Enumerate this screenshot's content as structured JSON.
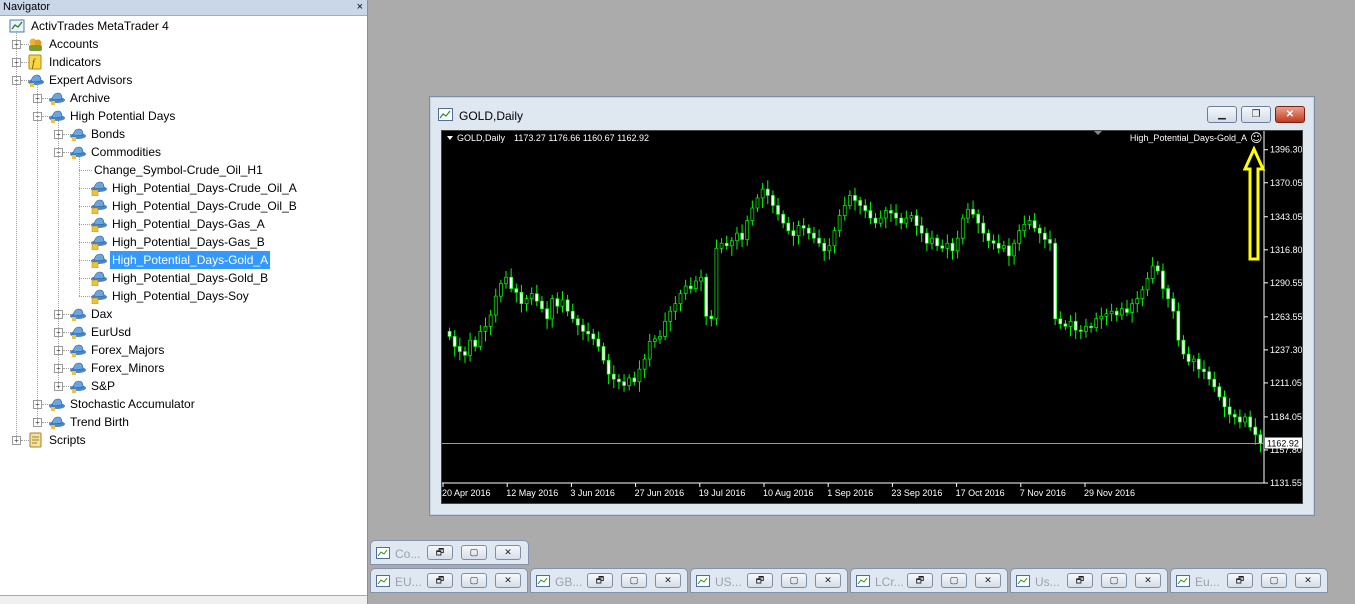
{
  "navigator": {
    "title": "Navigator",
    "close_glyph": "×",
    "tree": [
      {
        "label": "ActivTrades MetaTrader 4",
        "level": 0,
        "expander": "",
        "icon": "terminal-icon"
      },
      {
        "label": "Accounts",
        "level": 1,
        "expander": "+",
        "icon": "accounts-icon"
      },
      {
        "label": "Indicators",
        "level": 1,
        "expander": "+",
        "icon": "indicators-icon"
      },
      {
        "label": "Expert Advisors",
        "level": 1,
        "expander": "-",
        "icon": "expert-hat-icon"
      },
      {
        "label": "Archive",
        "level": 2,
        "expander": "+",
        "icon": "expert-hat-icon"
      },
      {
        "label": "High Potential Days",
        "level": 2,
        "expander": "-",
        "icon": "expert-hat-icon"
      },
      {
        "label": "Bonds",
        "level": 3,
        "expander": "+",
        "icon": "expert-hat-icon"
      },
      {
        "label": "Commodities",
        "level": 3,
        "expander": "-",
        "icon": "expert-hat-icon"
      },
      {
        "label": "Change_Symbol-Crude_Oil_H1",
        "level": 4,
        "expander": "",
        "icon": "none"
      },
      {
        "label": "High_Potential_Days-Crude_Oil_A",
        "level": 4,
        "expander": "",
        "icon": "expert-file-icon"
      },
      {
        "label": "High_Potential_Days-Crude_Oil_B",
        "level": 4,
        "expander": "",
        "icon": "expert-file-icon"
      },
      {
        "label": "High_Potential_Days-Gas_A",
        "level": 4,
        "expander": "",
        "icon": "expert-file-icon"
      },
      {
        "label": "High_Potential_Days-Gas_B",
        "level": 4,
        "expander": "",
        "icon": "expert-file-icon"
      },
      {
        "label": "High_Potential_Days-Gold_A",
        "level": 4,
        "expander": "",
        "icon": "expert-file-icon",
        "selected": true
      },
      {
        "label": "High_Potential_Days-Gold_B",
        "level": 4,
        "expander": "",
        "icon": "expert-file-icon"
      },
      {
        "label": "High_Potential_Days-Soy",
        "level": 4,
        "expander": "",
        "icon": "expert-file-icon"
      },
      {
        "label": "Dax",
        "level": 3,
        "expander": "+",
        "icon": "expert-hat-icon"
      },
      {
        "label": "EurUsd",
        "level": 3,
        "expander": "+",
        "icon": "expert-hat-icon"
      },
      {
        "label": "Forex_Majors",
        "level": 3,
        "expander": "+",
        "icon": "expert-hat-icon"
      },
      {
        "label": "Forex_Minors",
        "level": 3,
        "expander": "+",
        "icon": "expert-hat-icon"
      },
      {
        "label": "S&P",
        "level": 3,
        "expander": "+",
        "icon": "expert-hat-icon"
      },
      {
        "label": "Stochastic Accumulator",
        "level": 2,
        "expander": "+",
        "icon": "expert-hat-icon"
      },
      {
        "label": "Trend Birth",
        "level": 2,
        "expander": "+",
        "icon": "expert-hat-icon"
      },
      {
        "label": "Scripts",
        "level": 1,
        "expander": "+",
        "icon": "scripts-icon"
      }
    ]
  },
  "chart_window": {
    "title": "GOLD,Daily",
    "min_glyph": "▁",
    "restore_glyph": "❐",
    "close_glyph": "✕",
    "info_symbol": "GOLD,Daily",
    "info_ohlc": "1173.27 1176.66 1160.67 1162.92",
    "expert_name": "High_Potential_Days-Gold_A",
    "smiley": "☺",
    "current_price": "1162.92"
  },
  "colors": {
    "candle": "#00ff00",
    "chart_bg": "#000000",
    "axis_text": "#ffffff",
    "arrow": "#ffff00",
    "selection": "#3399ff"
  },
  "chart_data": {
    "type": "candlestick",
    "symbol": "GOLD",
    "timeframe": "Daily",
    "ylim": [
      1131.55,
      1408.0
    ],
    "y_ticks": [
      "1396.30",
      "1370.05",
      "1343.05",
      "1316.80",
      "1290.55",
      "1263.55",
      "1237.30",
      "1211.05",
      "1184.05",
      "1157.80",
      "1131.55"
    ],
    "x_ticks": [
      "20 Apr 2016",
      "12 May 2016",
      "3 Jun 2016",
      "27 Jun 2016",
      "19 Jul 2016",
      "10 Aug 2016",
      "1 Sep 2016",
      "23 Sep 2016",
      "17 Oct 2016",
      "7 Nov 2016",
      "29 Nov 2016"
    ],
    "bid_line": 1162.92,
    "closes": [
      1248,
      1240,
      1236,
      1233,
      1245,
      1240,
      1252,
      1256,
      1265,
      1280,
      1290,
      1295,
      1286,
      1283,
      1274,
      1278,
      1282,
      1276,
      1270,
      1262,
      1278,
      1272,
      1277,
      1268,
      1262,
      1257,
      1252,
      1250,
      1246,
      1240,
      1229,
      1218,
      1214,
      1212,
      1209,
      1215,
      1212,
      1222,
      1230,
      1244,
      1246,
      1248,
      1260,
      1268,
      1274,
      1282,
      1288,
      1286,
      1292,
      1295,
      1264,
      1262,
      1318,
      1322,
      1320,
      1324,
      1330,
      1325,
      1340,
      1350,
      1358,
      1365,
      1360,
      1352,
      1345,
      1338,
      1332,
      1328,
      1336,
      1334,
      1330,
      1326,
      1322,
      1316,
      1320,
      1332,
      1344,
      1352,
      1360,
      1356,
      1352,
      1348,
      1342,
      1338,
      1342,
      1348,
      1346,
      1342,
      1338,
      1342,
      1344,
      1336,
      1330,
      1322,
      1326,
      1320,
      1318,
      1322,
      1316,
      1326,
      1342,
      1349,
      1345,
      1338,
      1330,
      1324,
      1322,
      1318,
      1320,
      1312,
      1322,
      1332,
      1337,
      1340,
      1334,
      1330,
      1325,
      1322,
      1262,
      1258,
      1256,
      1260,
      1253,
      1252,
      1256,
      1255,
      1262,
      1264,
      1266,
      1268,
      1265,
      1270,
      1267,
      1274,
      1278,
      1285,
      1294,
      1304,
      1300,
      1286,
      1278,
      1268,
      1245,
      1234,
      1228,
      1230,
      1222,
      1220,
      1214,
      1208,
      1200,
      1192,
      1186,
      1184,
      1180,
      1184,
      1176,
      1170,
      1162.92
    ]
  },
  "minimized_windows": [
    {
      "title": "Co...",
      "row": 0
    },
    {
      "title": "EU...",
      "row": 1
    },
    {
      "title": "GB...",
      "row": 1
    },
    {
      "title": "US...",
      "row": 1
    },
    {
      "title": "LCr...",
      "row": 1
    },
    {
      "title": "Us...",
      "row": 1
    },
    {
      "title": "Eu...",
      "row": 1
    }
  ],
  "min_btn_glyphs": {
    "minimize": "🗗",
    "maximize": "▢",
    "close": "✕"
  }
}
